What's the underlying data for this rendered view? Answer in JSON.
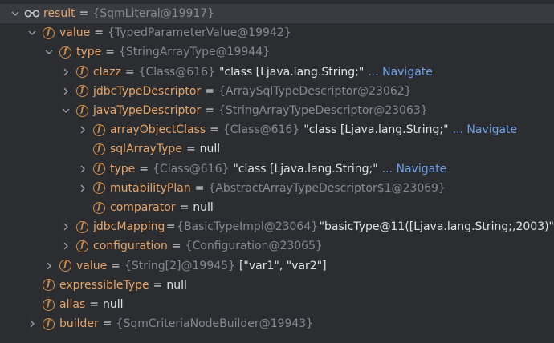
{
  "rows": [
    {
      "level": 0,
      "arrow": "down",
      "icon": "glasses",
      "name": "result",
      "eq": "=",
      "ref": "{SqmLiteral@19917}",
      "value": "",
      "nav": "",
      "selected": true
    },
    {
      "level": 1,
      "arrow": "down",
      "icon": "f",
      "name": "value",
      "eq": "=",
      "ref": "{TypedParameterValue@19942}",
      "value": "",
      "nav": ""
    },
    {
      "level": 2,
      "arrow": "down",
      "icon": "f",
      "name": "type",
      "eq": "=",
      "ref": "{StringArrayType@19944}",
      "value": "",
      "nav": ""
    },
    {
      "level": 3,
      "arrow": "right",
      "icon": "f",
      "name": "clazz",
      "eq": "=",
      "ref": "{Class@616}",
      "value": "\"class [Ljava.lang.String;\"",
      "nav": "... Navigate"
    },
    {
      "level": 3,
      "arrow": "right",
      "icon": "f",
      "name": "jdbcTypeDescriptor",
      "eq": "=",
      "ref": "{ArraySqlTypeDescriptor@23062}",
      "value": "",
      "nav": ""
    },
    {
      "level": 3,
      "arrow": "down",
      "icon": "f",
      "name": "javaTypeDescriptor",
      "eq": "=",
      "ref": "{StringArrayTypeDescriptor@23063}",
      "value": "",
      "nav": ""
    },
    {
      "level": 4,
      "arrow": "right",
      "icon": "f",
      "name": "arrayObjectClass",
      "eq": "=",
      "ref": "{Class@616}",
      "value": "\"class [Ljava.lang.String;\"",
      "nav": "... Navigate"
    },
    {
      "level": 4,
      "arrow": "none",
      "icon": "f",
      "name": "sqlArrayType",
      "eq": "=",
      "ref": "",
      "value": "null",
      "nav": ""
    },
    {
      "level": 4,
      "arrow": "right",
      "icon": "f",
      "name": "type",
      "eq": "=",
      "ref": "{Class@616}",
      "value": "\"class [Ljava.lang.String;\"",
      "nav": "... Navigate"
    },
    {
      "level": 4,
      "arrow": "right",
      "icon": "f",
      "name": "mutabilityPlan",
      "eq": "=",
      "ref": "{AbstractArrayTypeDescriptor$1@23069}",
      "value": "",
      "nav": ""
    },
    {
      "level": 4,
      "arrow": "none",
      "icon": "f",
      "name": "comparator",
      "eq": "=",
      "ref": "",
      "value": "null",
      "nav": ""
    },
    {
      "level": 3,
      "arrow": "right",
      "icon": "f",
      "name": "jdbcMapping",
      "eq": "=",
      "ref": "{BasicTypeImpl@23064}",
      "value": "\"basicType@11([Ljava.lang.String;,2003)\"",
      "nav": ""
    },
    {
      "level": 3,
      "arrow": "right",
      "icon": "f",
      "name": "configuration",
      "eq": "=",
      "ref": "{Configuration@23065}",
      "value": "",
      "nav": ""
    },
    {
      "level": 2,
      "arrow": "right",
      "icon": "f",
      "name": "value",
      "eq": "=",
      "ref": "{String[2]@19945}",
      "value": "[\"var1\", \"var2\"]",
      "nav": ""
    },
    {
      "level": 1,
      "arrow": "none",
      "icon": "f",
      "name": "expressibleType",
      "eq": "=",
      "ref": "",
      "value": "null",
      "nav": ""
    },
    {
      "level": 1,
      "arrow": "none",
      "icon": "f",
      "name": "alias",
      "eq": "=",
      "ref": "",
      "value": "null",
      "nav": ""
    },
    {
      "level": 1,
      "arrow": "right",
      "icon": "f",
      "name": "builder",
      "eq": "=",
      "ref": "{SqmCriteriaNodeBuilder@19943}",
      "value": "",
      "nav": ""
    }
  ],
  "colors": {
    "background": "#2b2d30",
    "selected_row": "#393b40",
    "field_name": "#e6a46b",
    "reference": "#868a91",
    "navigate_link": "#6f9fe8",
    "field_icon": "#d4904c"
  },
  "icons": {
    "expanded": "chevron-down-icon",
    "collapsed": "chevron-right-icon",
    "field": "field-icon",
    "watch": "glasses-icon"
  }
}
